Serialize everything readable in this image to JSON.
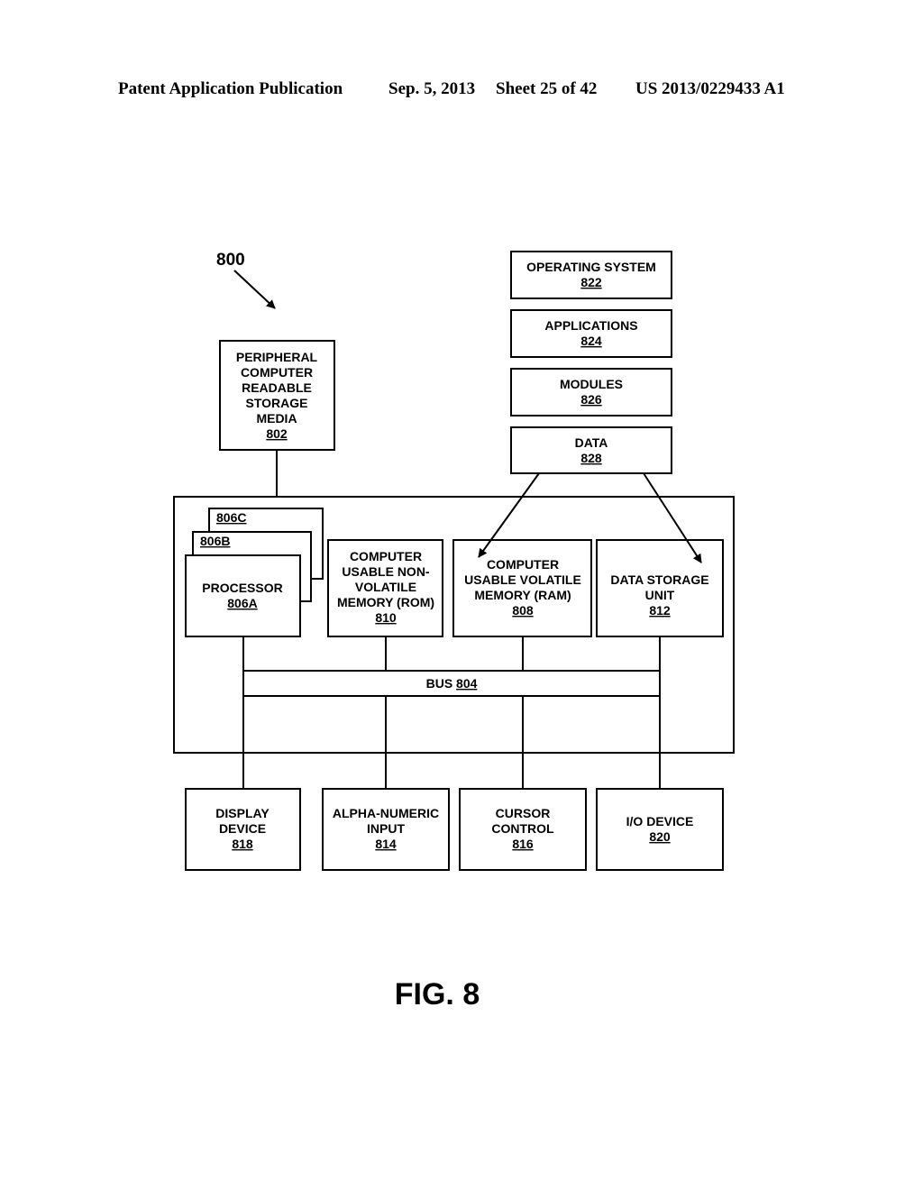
{
  "header": {
    "publication": "Patent Application Publication",
    "date": "Sep. 5, 2013",
    "sheet": "Sheet 25 of 42",
    "number": "US 2013/0229433 A1"
  },
  "figure": {
    "ref": "800",
    "caption": "FIG. 8"
  },
  "software": {
    "os": {
      "label": "OPERATING SYSTEM",
      "ref": "822"
    },
    "applications": {
      "label": "APPLICATIONS",
      "ref": "824"
    },
    "modules": {
      "label": "MODULES",
      "ref": "826"
    },
    "data": {
      "label": "DATA",
      "ref": "828"
    }
  },
  "peripheral": {
    "lines": [
      "PERIPHERAL",
      "COMPUTER",
      "READABLE",
      "STORAGE",
      "MEDIA"
    ],
    "ref": "802"
  },
  "processors": {
    "c": {
      "ref": "806C"
    },
    "b": {
      "ref": "806B"
    },
    "a": {
      "label": "PROCESSOR",
      "ref": "806A"
    }
  },
  "rom": {
    "lines": [
      "COMPUTER",
      "USABLE NON-",
      "VOLATILE",
      "MEMORY (ROM)"
    ],
    "ref": "810"
  },
  "ram": {
    "lines": [
      "COMPUTER",
      "USABLE VOLATILE",
      "MEMORY (RAM)"
    ],
    "ref": "808"
  },
  "storage": {
    "lines": [
      "DATA STORAGE",
      "UNIT"
    ],
    "ref": "812"
  },
  "bus": {
    "label": "BUS",
    "ref": "804"
  },
  "devices": {
    "display": {
      "lines": [
        "DISPLAY",
        "DEVICE"
      ],
      "ref": "818"
    },
    "alpha": {
      "lines": [
        "ALPHA-NUMERIC",
        "INPUT"
      ],
      "ref": "814"
    },
    "cursor": {
      "lines": [
        "CURSOR",
        "CONTROL"
      ],
      "ref": "816"
    },
    "io": {
      "lines": [
        "I/O DEVICE"
      ],
      "ref": "820"
    }
  }
}
